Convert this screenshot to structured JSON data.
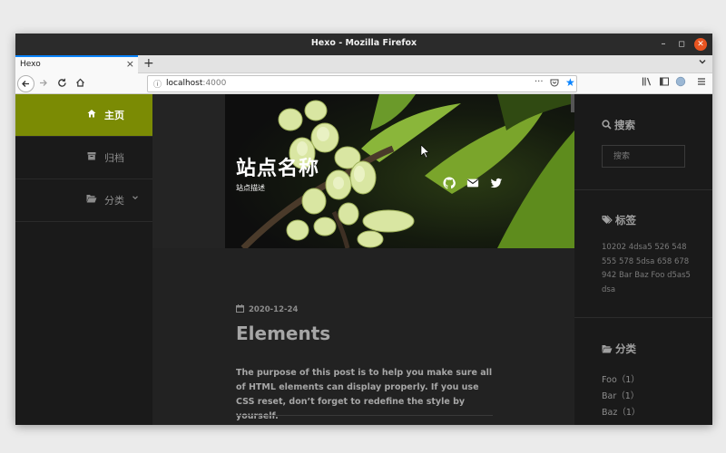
{
  "window": {
    "title": "Hexo - Mozilla Firefox"
  },
  "tab": {
    "title": "Hexo"
  },
  "urlbar": {
    "host": "localhost",
    "port": ":4000"
  },
  "sidebar": {
    "items": [
      {
        "label": "主页",
        "icon": "home-icon",
        "active": true
      },
      {
        "label": "归档",
        "icon": "archive-icon",
        "active": false
      },
      {
        "label": "分类",
        "icon": "folder-open-icon",
        "active": false,
        "has_submenu": true
      }
    ]
  },
  "hero": {
    "site_title": "站点名称",
    "site_description": "站点描述",
    "social": [
      "github-icon",
      "envelope-icon",
      "twitter-icon"
    ]
  },
  "post": {
    "date": "2020-12-24",
    "title": "Elements",
    "excerpt": "The purpose of this post is to help you make sure all of HTML elements can display properly. If you use CSS reset, don’t forget to redefine the style by yourself."
  },
  "widgets": {
    "search": {
      "title": "搜索",
      "placeholder": "搜索"
    },
    "tags": {
      "title": "标签",
      "items": [
        "10202",
        "4dsa5",
        "526",
        "548",
        "555",
        "578",
        "5dsa",
        "658",
        "678",
        "942",
        "Bar",
        "Baz",
        "Foo",
        "d5as5",
        "dsa"
      ]
    },
    "categories": {
      "title": "分类",
      "items": [
        {
          "label": "Foo（1）"
        },
        {
          "label": "Bar（1）"
        },
        {
          "label": "Baz（1）"
        }
      ]
    }
  },
  "colors": {
    "accent": "#7b8b04",
    "background": "#1f1f1f",
    "firefox_blue": "#0a84ff"
  }
}
